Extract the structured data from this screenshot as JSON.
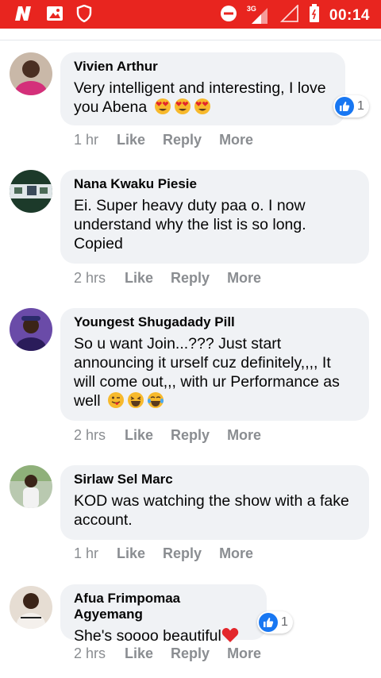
{
  "status_bar": {
    "network": "3G",
    "time": "00:14",
    "icons": [
      "n-app-icon",
      "gallery-icon",
      "shield-icon",
      "do-not-disturb-icon",
      "signal-icon",
      "signal-empty-icon",
      "battery-icon"
    ],
    "color": "#e8251f"
  },
  "actions": {
    "like": "Like",
    "reply": "Reply",
    "more": "More"
  },
  "comments": [
    {
      "author": "Vivien Arthur",
      "text": "Very intelligent and interesting, I love you Abena",
      "emojis": [
        "heart-eyes-emoji",
        "heart-eyes-emoji",
        "heart-eyes-emoji"
      ],
      "time": "1 hr",
      "reactions": "1"
    },
    {
      "author": "Nana Kwaku Piesie",
      "text": "Ei. Super heavy duty paa o. I now understand why the list is so long. Copied",
      "time": "2 hrs"
    },
    {
      "author": "Youngest Shugadady Pill",
      "text": "So u want Join...??? Just start announcing it urself cuz definitely,,,, It will come out,,, with ur Performance as well",
      "emojis": [
        "tongue-wink-emoji",
        "laughing-emoji",
        "tears-of-joy-emoji"
      ],
      "time": "2 hrs"
    },
    {
      "author": "Sirlaw Sel Marc",
      "text": "KOD was watching the show with a fake account.",
      "time": "1 hr"
    },
    {
      "author": "Afua Frimpomaa Agyemang",
      "text": "She's soooo beautiful",
      "emojis": [
        "red-heart-emoji"
      ],
      "time": "2 hrs",
      "reactions": "1"
    }
  ]
}
